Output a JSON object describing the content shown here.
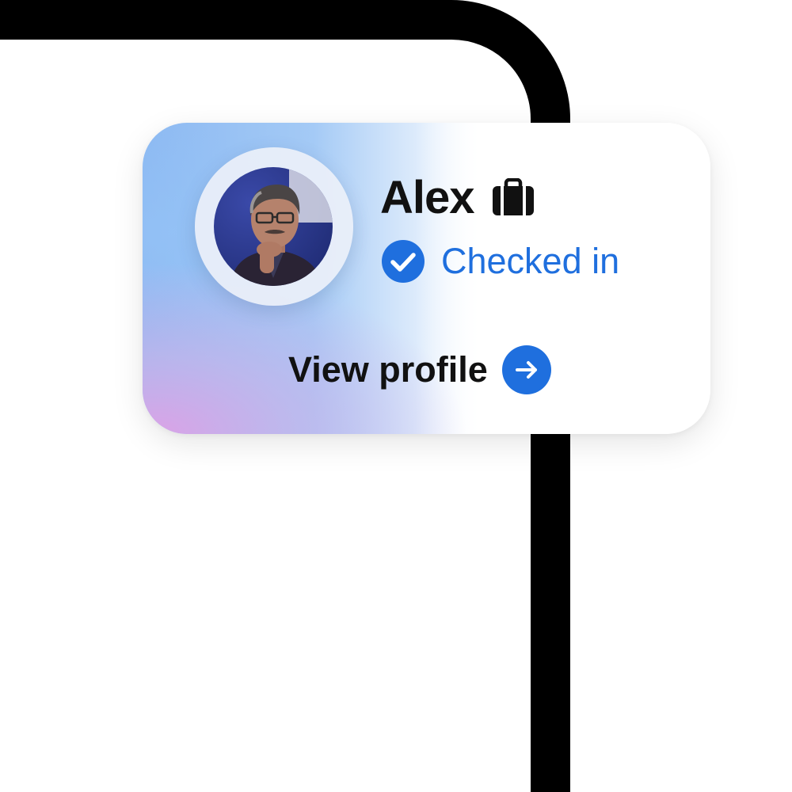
{
  "card": {
    "name": "Alex",
    "status": "Checked in",
    "action_label": "View profile"
  },
  "icons": {
    "name_badge": "briefcase-icon",
    "status": "check-circle-icon",
    "action": "arrow-right-circle-icon"
  },
  "colors": {
    "accent": "#1f6fde",
    "text": "#111111",
    "frame": "#000000",
    "card_gradient_blue": "#8fbef4",
    "card_gradient_pink": "#d9a3e6"
  }
}
